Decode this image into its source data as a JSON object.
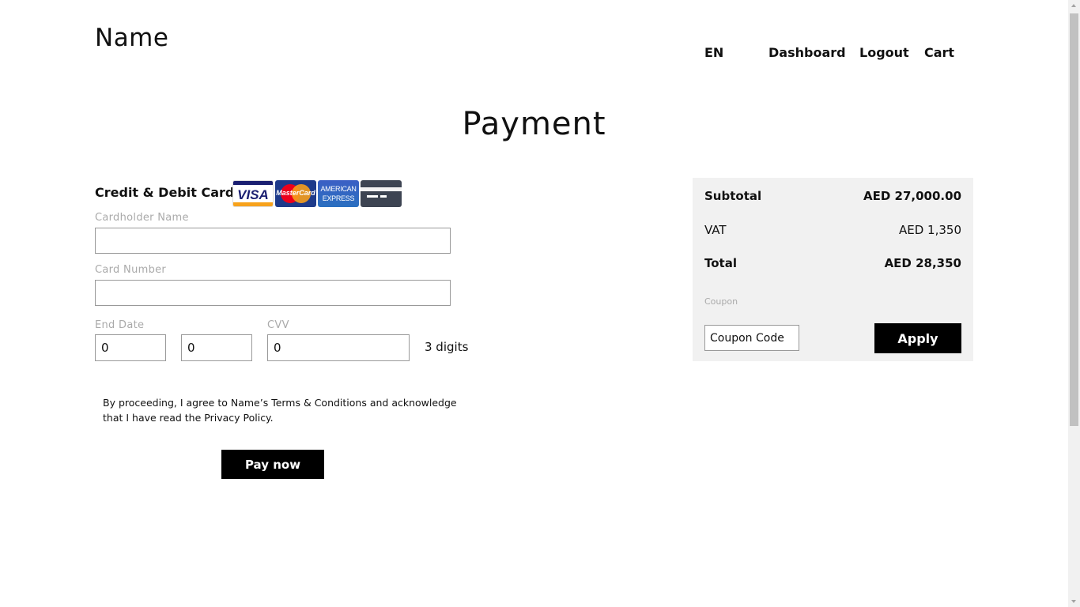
{
  "header": {
    "brand": "Name",
    "nav": {
      "language": "EN",
      "dashboard": "Dashboard",
      "logout": "Logout",
      "cart": "Cart"
    }
  },
  "page_title": "Payment",
  "payment_form": {
    "section_title": "Credit & Debit Card",
    "card_logos": [
      {
        "name": "visa",
        "text": "VISA"
      },
      {
        "name": "mastercard",
        "text": "MasterCard"
      },
      {
        "name": "american-express",
        "text": "AMERICAN EXPRESS"
      },
      {
        "name": "generic-card",
        "text": ""
      }
    ],
    "cardholder_name": {
      "label": "Cardholder Name",
      "value": ""
    },
    "card_number": {
      "label": "Card Number",
      "value": ""
    },
    "end_date": {
      "label": "End Date",
      "month": "0",
      "year": "0"
    },
    "cvv": {
      "label": "CVV",
      "value": "0",
      "hint": "3 digits"
    },
    "terms_text": "By proceeding, I agree to Name’s Terms & Conditions and acknowledge that I have read the Privacy Policy.",
    "pay_button": "Pay now"
  },
  "summary": {
    "subtotal_label": "Subtotal",
    "subtotal_value": "AED 27,000.00",
    "vat_label": "VAT",
    "vat_value": "AED 1,350",
    "total_label": "Total",
    "total_value": "AED 28,350",
    "coupon_label": "Coupon",
    "coupon_placeholder": "Coupon Code",
    "apply_button": "Apply"
  },
  "colors": {
    "primary_button": "#000000",
    "summary_background": "#f1f1f1",
    "label_text": "#aaaaaa"
  }
}
